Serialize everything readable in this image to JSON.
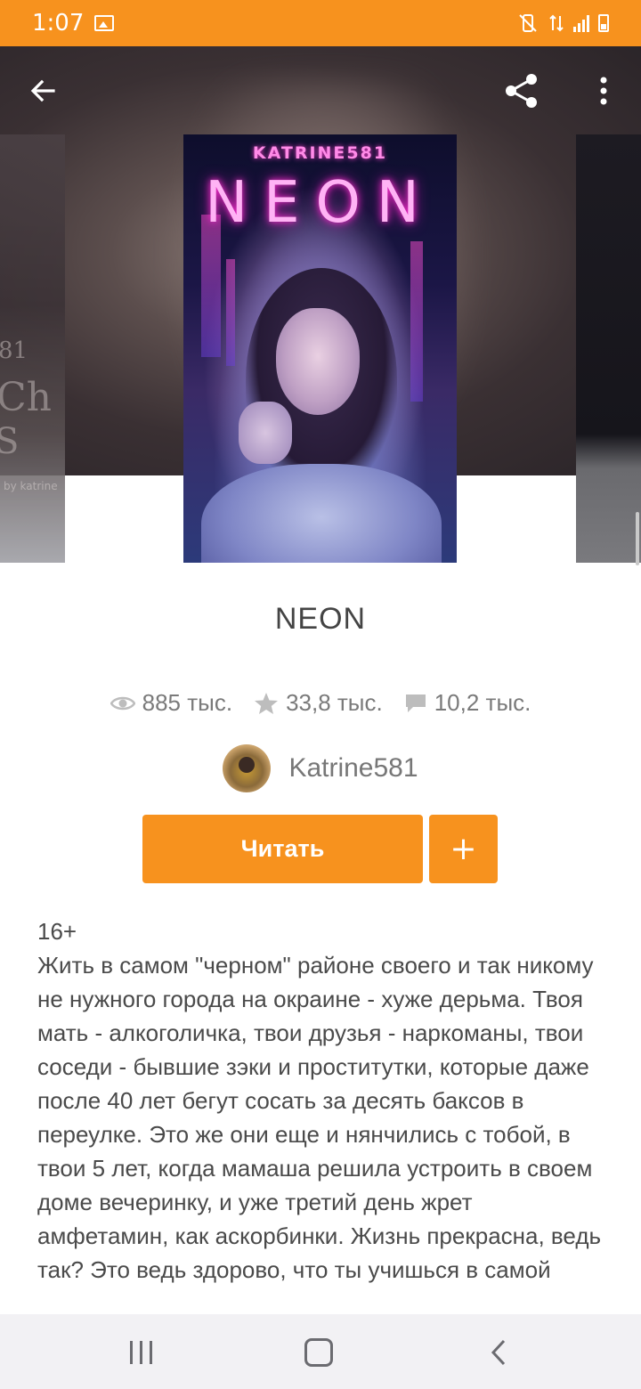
{
  "status_bar": {
    "time": "1:07"
  },
  "book": {
    "cover_author": "KATRINE581",
    "cover_title": "NEON",
    "title": "NEON",
    "stats": {
      "views": "885 тыс.",
      "votes": "33,8 тыс.",
      "comments": "10,2 тыс."
    },
    "author": "Katrine581",
    "read_label": "Читать",
    "add_label": "+",
    "description": "16+\nЖить в самом \"черном\" районе своего и так никому не нужного города на окраине - хуже дерьма. Твоя мать - алкоголичка, твои друзья - наркоманы, твои соседи - бывшие зэки и проститутки, которые даже после 40 лет бегут сосать за десять баксов в переулке. Это же они еще и нянчились с тобой, в твои 5 лет, когда мамаша решила устроить в своем доме вечеринку, и уже третий день жрет амфетамин, как аскорбинки. Жизнь прекрасна, ведь так? Это ведь здорово, что ты учишься в самой"
  },
  "side_cover_left_text": [
    "81",
    "Ch",
    "S",
    "by katrine"
  ],
  "colors": {
    "accent": "#f7921e"
  },
  "icons": [
    "back-arrow-icon",
    "share-icon",
    "more-vert-icon",
    "eye-icon",
    "star-icon",
    "comment-icon"
  ]
}
